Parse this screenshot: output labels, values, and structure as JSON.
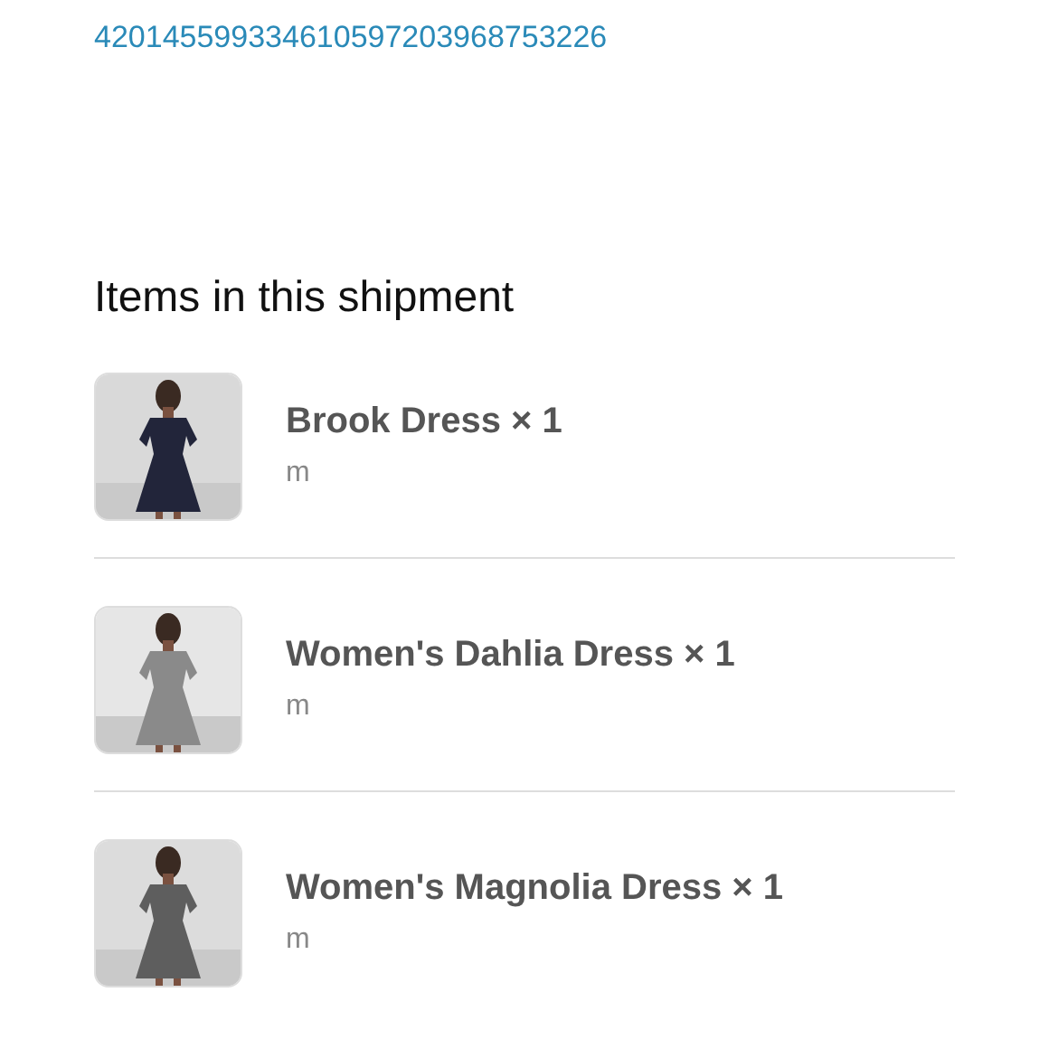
{
  "tracking_number": "420145599334610597203968753226",
  "section_title": "Items in this shipment",
  "items": [
    {
      "name": "Brook Dress × 1",
      "size": "m"
    },
    {
      "name": "Women's Dahlia Dress × 1",
      "size": "m"
    },
    {
      "name": "Women's Magnolia Dress × 1",
      "size": "m"
    }
  ]
}
